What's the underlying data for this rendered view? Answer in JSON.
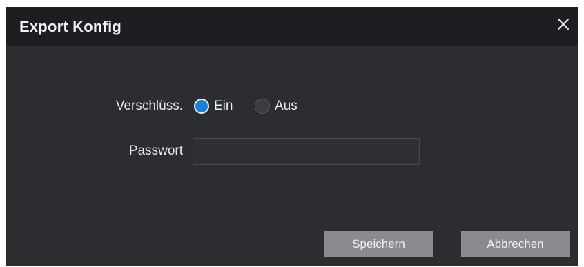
{
  "dialog": {
    "title": "Export Konfig",
    "close_icon": "close-icon"
  },
  "form": {
    "encryption": {
      "label": "Verschlüss.",
      "options": [
        {
          "label": "Ein",
          "checked": true
        },
        {
          "label": "Aus",
          "checked": false
        }
      ]
    },
    "password": {
      "label": "Passwort",
      "value": "",
      "placeholder": ""
    }
  },
  "buttons": {
    "save_label": "Speichern",
    "cancel_label": "Abbrechen"
  },
  "colors": {
    "dialog_bg": "#2c2d31",
    "titlebar_bg": "#1d1e21",
    "radio_accent": "#1a7fd8",
    "button_bg": "#8a8b8f"
  }
}
